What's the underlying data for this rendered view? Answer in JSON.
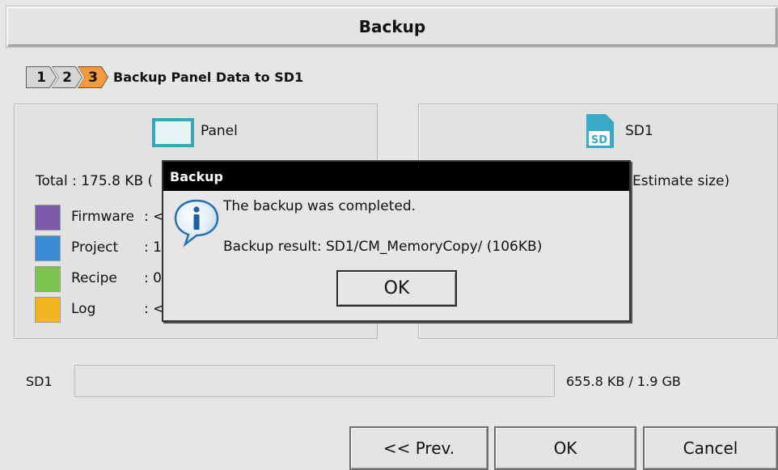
{
  "window": {
    "title": "Backup"
  },
  "steps": {
    "items": [
      {
        "label": "1",
        "state": "done"
      },
      {
        "label": "2",
        "state": "done"
      },
      {
        "label": "3",
        "state": "active"
      }
    ],
    "title": "Backup Panel Data to SD1"
  },
  "source": {
    "name": "Panel",
    "icon": "panel-icon",
    "total": "Total : 175.8 KB (",
    "legend": [
      {
        "label": "Firmware",
        "value": ": <",
        "color": "#7b5aa8"
      },
      {
        "label": "Project",
        "value": ": 1",
        "color": "#3a8dd2"
      },
      {
        "label": "Recipe",
        "value": ": 0",
        "color": "#7ec24f"
      },
      {
        "label": "Log",
        "value": ": <",
        "color": "#f2b51f"
      }
    ]
  },
  "destination": {
    "name": "SD1",
    "icon": "sd-card-icon",
    "icon_text": "SD",
    "estimate": "Estimate size)"
  },
  "storage": {
    "label": "SD1",
    "usage": "655.8 KB / 1.9 GB",
    "used_fraction": 0.0003
  },
  "buttons": {
    "prev": "<< Prev.",
    "ok": "OK",
    "cancel": "Cancel"
  },
  "dialog": {
    "title": "Backup",
    "icon": "info-icon",
    "message": "The backup was completed.",
    "result": "Backup result: SD1/CM_MemoryCopy/ (106KB)",
    "ok": "OK"
  },
  "colors": {
    "accent_step": "#f39a3d",
    "panel_icon": "#3aa7b8",
    "sd_icon": "#39a9c6",
    "info_icon": "#2a6fb3"
  }
}
